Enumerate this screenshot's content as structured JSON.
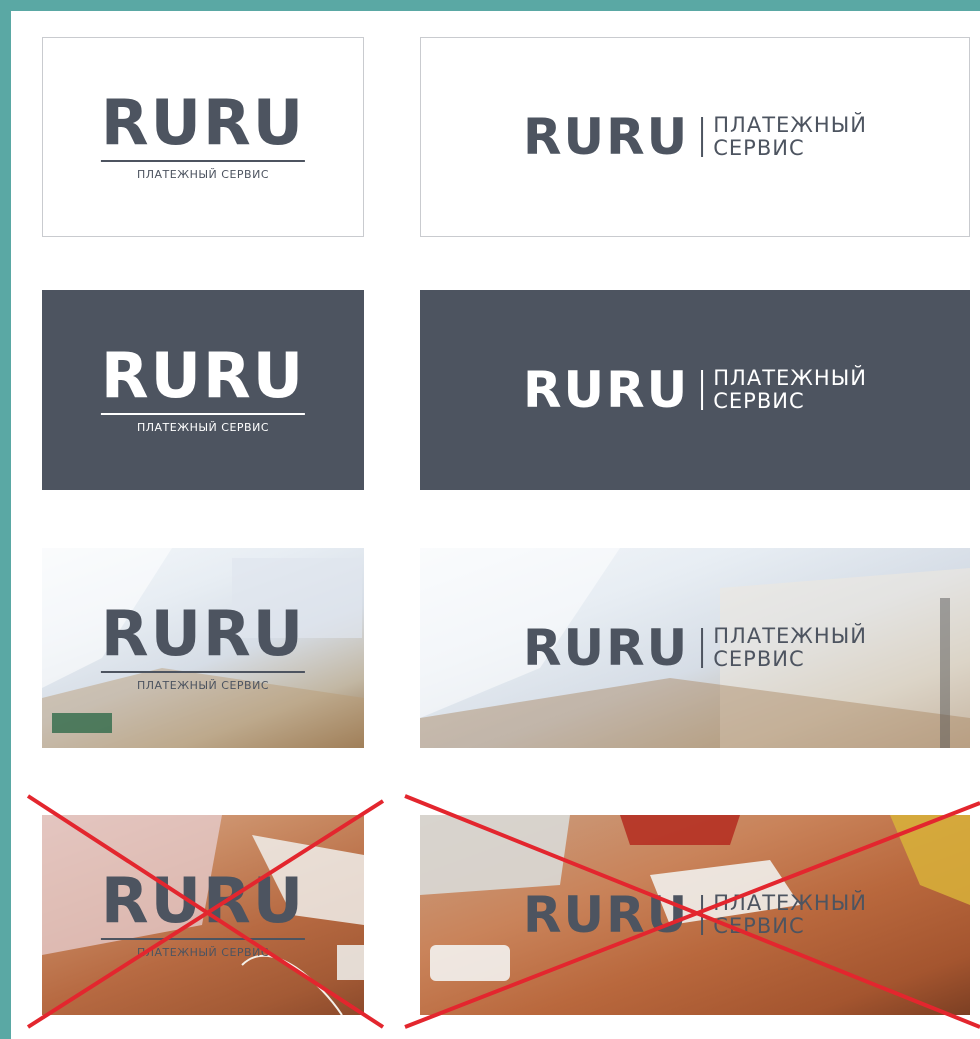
{
  "logo": {
    "brand": "RURU",
    "tagline_single": "ПЛАТЕЖНЫЙ СЕРВИС",
    "tagline_line1": "ПЛАТЕЖНЫЙ",
    "tagline_line2": "СЕРВИС"
  },
  "colors": {
    "brand_gray": "#4d5460",
    "frame": "#5aa8a4",
    "cross_red": "#e3262e"
  }
}
